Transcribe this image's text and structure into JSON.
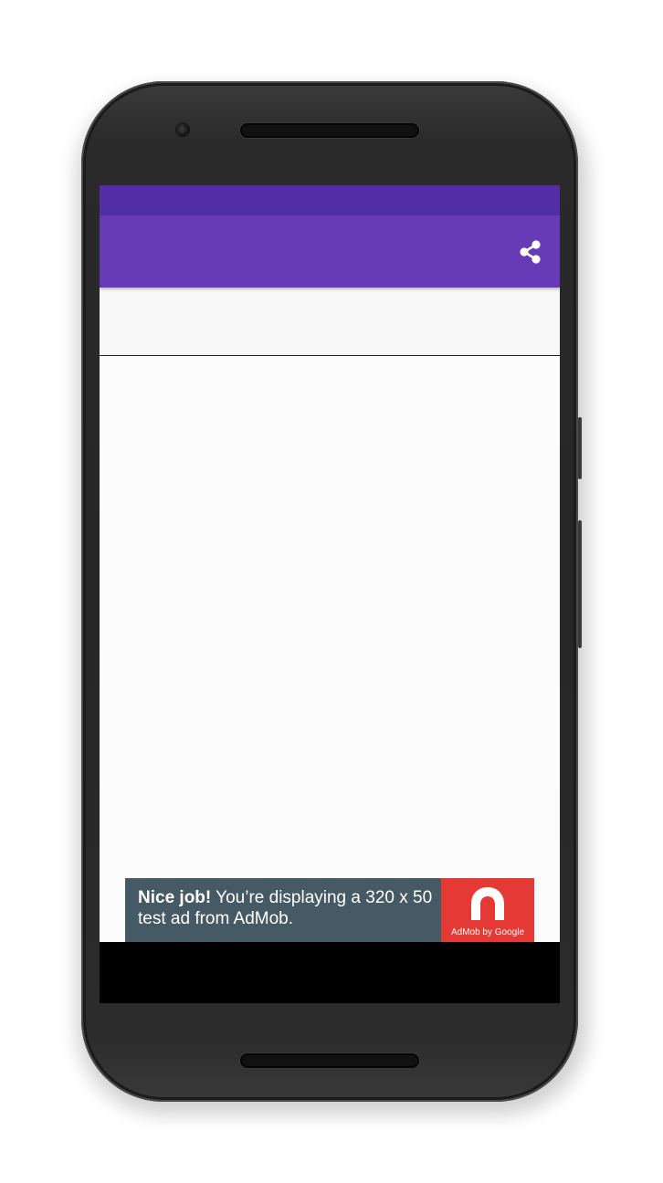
{
  "app_bar": {
    "title": "",
    "actions": [
      {
        "name": "share",
        "icon": "share-icon"
      }
    ]
  },
  "content": {
    "header_text": ""
  },
  "ad": {
    "headline": "Nice job!",
    "body": " You’re displaying a 320 x 50 test ad from AdMob.",
    "logo_caption": "AdMob by Google"
  },
  "colors": {
    "status_bar": "#512da8",
    "app_bar": "#673ab7",
    "ad_background": "#455a64",
    "ad_logo_background": "#e53935"
  }
}
